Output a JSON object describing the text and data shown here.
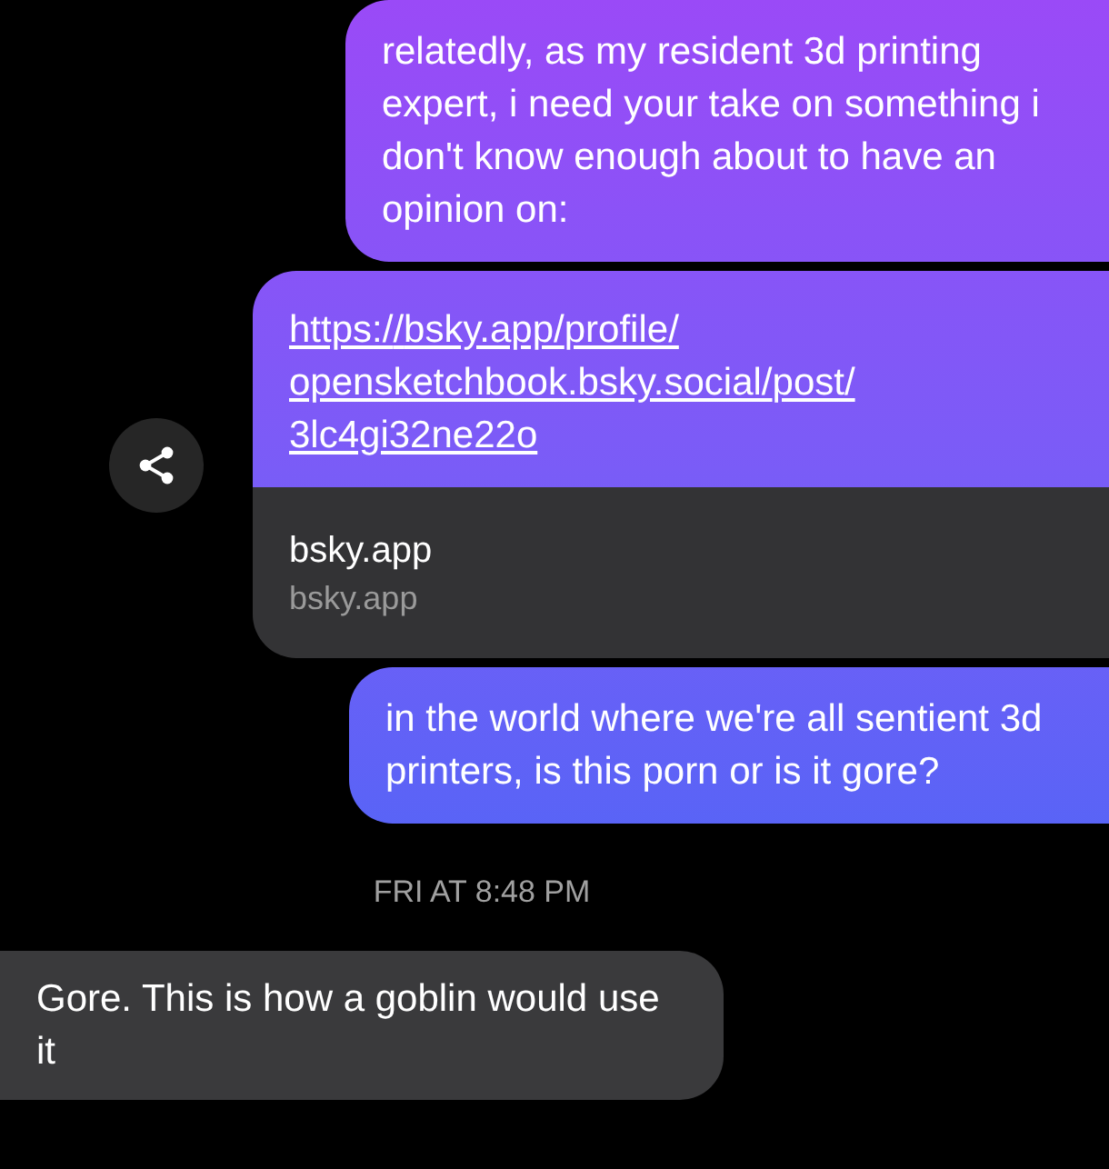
{
  "messages": [
    {
      "kind": "sent",
      "text": "relatedly, as my resident 3d printing expert, i need your take on something i don't know enough about to have an opinion on:"
    },
    {
      "kind": "link",
      "url": "https://bsky.app/profile/opensketchbook.bsky.social/post/3lc4gi32ne22o",
      "preview_title": "bsky.app",
      "preview_domain": "bsky.app"
    },
    {
      "kind": "sent",
      "text": "in the world where we're all sentient 3d printers, is this porn or is it gore?"
    },
    {
      "kind": "timestamp",
      "text": "FRI AT 8:48 PM"
    },
    {
      "kind": "received",
      "text": "Gore. This is how a goblin would use it"
    }
  ]
}
